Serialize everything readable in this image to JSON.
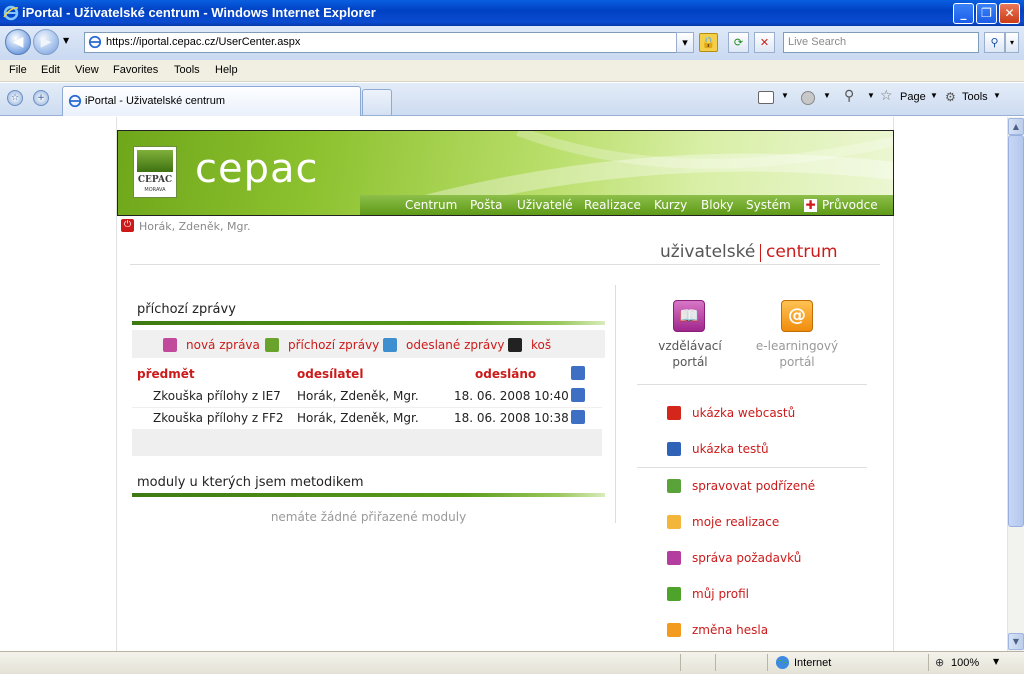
{
  "window": {
    "title": "iPortal - Uživatelské centrum - Windows Internet Explorer"
  },
  "address": {
    "url": "https://iportal.cepac.cz/UserCenter.aspx",
    "search_placeholder": "Live Search"
  },
  "menu": [
    "File",
    "Edit",
    "View",
    "Favorites",
    "Tools",
    "Help"
  ],
  "tab": {
    "label": "iPortal - Uživatelské centrum"
  },
  "commands": {
    "page": "Page",
    "tools": "Tools"
  },
  "site": {
    "brand": "cepac",
    "logo_text": "CEPAC",
    "logo_sub": "MORAVA",
    "nav": [
      "Centrum",
      "Pošta",
      "Uživatelé",
      "Realizace",
      "Kurzy",
      "Bloky",
      "Systém",
      "Průvodce"
    ],
    "user": "Horák, Zdeněk, Mgr.",
    "center_title_a": "uživatelské",
    "center_title_b": "centrum"
  },
  "inbox": {
    "title": "příchozí zprávy",
    "toolbar": [
      "nová zpráva",
      "příchozí zprávy",
      "odeslané zprávy",
      "koš"
    ],
    "columns": [
      "předmět",
      "odesílatel",
      "odesláno"
    ],
    "rows": [
      {
        "subject": "Zkouška přílohy z IE7",
        "sender": "Horák, Zdeněk, Mgr.",
        "sent": "18. 06. 2008 10:40"
      },
      {
        "subject": "Zkouška přílohy z FF2",
        "sender": "Horák, Zdeněk, Mgr.",
        "sent": "18. 06. 2008 10:38"
      }
    ]
  },
  "modules": {
    "title": "moduly u kterých jsem metodikem",
    "empty": "nemáte žádné přiřazené moduly"
  },
  "portals": {
    "edu_line1": "vzdělávací",
    "edu_line2": "portál",
    "el_line1": "e-learningový",
    "el_line2": "portál"
  },
  "links": [
    "ukázka webcastů",
    "ukázka testů",
    "spravovat podřízené",
    "moje realizace",
    "správa požadavků",
    "můj profil",
    "změna hesla"
  ],
  "status": {
    "zone": "Internet",
    "zoom": "100%"
  },
  "colors": {
    "accent_red": "#cc1a1a",
    "banner_green": "#8cc12e",
    "ie_blue": "#0a4bd0"
  }
}
